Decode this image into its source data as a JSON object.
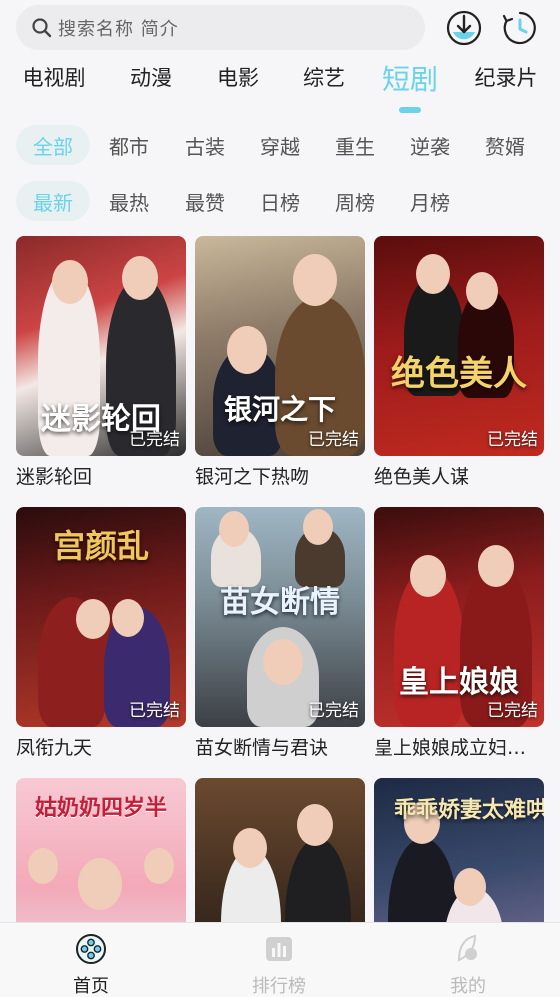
{
  "search": {
    "placeholder": "搜索名称 简介"
  },
  "toolbar": {
    "download_icon": "download-icon",
    "history_icon": "history-icon"
  },
  "categories": [
    {
      "label": "电视剧"
    },
    {
      "label": "动漫"
    },
    {
      "label": "电影"
    },
    {
      "label": "综艺"
    },
    {
      "label": "短剧",
      "active": true
    },
    {
      "label": "纪录片"
    }
  ],
  "genre_filters": [
    {
      "label": "全部",
      "active": true
    },
    {
      "label": "都市"
    },
    {
      "label": "古装"
    },
    {
      "label": "穿越"
    },
    {
      "label": "重生"
    },
    {
      "label": "逆袭"
    },
    {
      "label": "赘婿"
    }
  ],
  "sort_filters": [
    {
      "label": "最新",
      "active": true
    },
    {
      "label": "最热"
    },
    {
      "label": "最赞"
    },
    {
      "label": "日榜"
    },
    {
      "label": "周榜"
    },
    {
      "label": "月榜"
    }
  ],
  "dramas": [
    {
      "name": "迷影轮回",
      "status": "已完结",
      "poster_title": "迷影轮回"
    },
    {
      "name": "银河之下热吻",
      "status": "已完结",
      "poster_title": "银河之下"
    },
    {
      "name": "绝色美人谋",
      "status": "已完结",
      "poster_title": "绝色美人"
    },
    {
      "name": "凤衔九天",
      "status": "已完结",
      "poster_title": "宫颜乱"
    },
    {
      "name": "苗女断情与君诀",
      "status": "已完结",
      "poster_title": "苗女断情"
    },
    {
      "name": "皇上娘娘成立妇联了",
      "status": "已完结",
      "poster_title": "皇上娘娘"
    },
    {
      "name": "",
      "status": "",
      "poster_title": "姑奶奶四岁半"
    },
    {
      "name": "",
      "status": "",
      "poster_title": ""
    },
    {
      "name": "",
      "status": "",
      "poster_title": "乖乖娇妻太难哄"
    }
  ],
  "colors": {
    "accent": "#6ad3ea"
  },
  "bottom_nav": [
    {
      "label": "首页",
      "icon": "home-film-icon",
      "active": true
    },
    {
      "label": "排行榜",
      "icon": "ranking-icon"
    },
    {
      "label": "我的",
      "icon": "profile-icon"
    }
  ]
}
